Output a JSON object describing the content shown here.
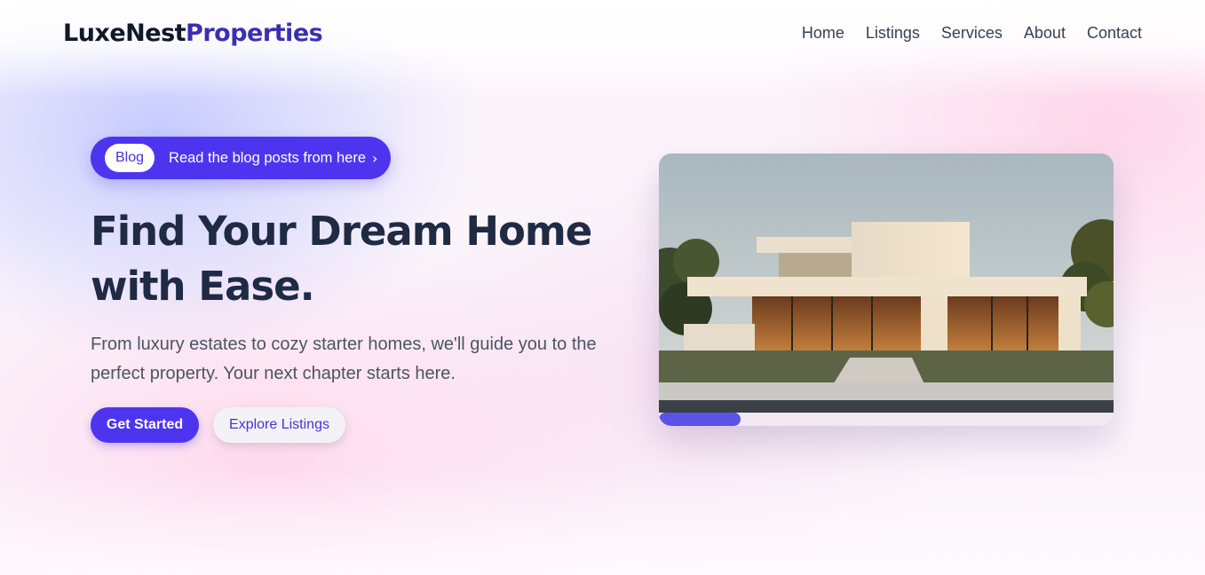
{
  "brand": {
    "part1": "LuxeNest",
    "part2": "Properties"
  },
  "nav": {
    "items": [
      {
        "label": "Home"
      },
      {
        "label": "Listings"
      },
      {
        "label": "Services"
      },
      {
        "label": "About"
      },
      {
        "label": "Contact"
      }
    ]
  },
  "hero": {
    "badge": {
      "tag": "Blog",
      "text": "Read the blog posts from here",
      "icon": "chevron-right-icon"
    },
    "title": "Find Your Dream Home with Ease.",
    "subtitle": "From luxury estates to cozy starter homes, we'll guide you to the perfect property. Your next chapter starts here.",
    "primary_cta": "Get Started",
    "secondary_cta": "Explore Listings"
  },
  "slider": {
    "image": "modern-house-photo",
    "progress_fraction": 0.18
  },
  "colors": {
    "accent": "#4d35f0",
    "brand_secondary": "#3b2fb0",
    "heading": "#1f2a44"
  }
}
